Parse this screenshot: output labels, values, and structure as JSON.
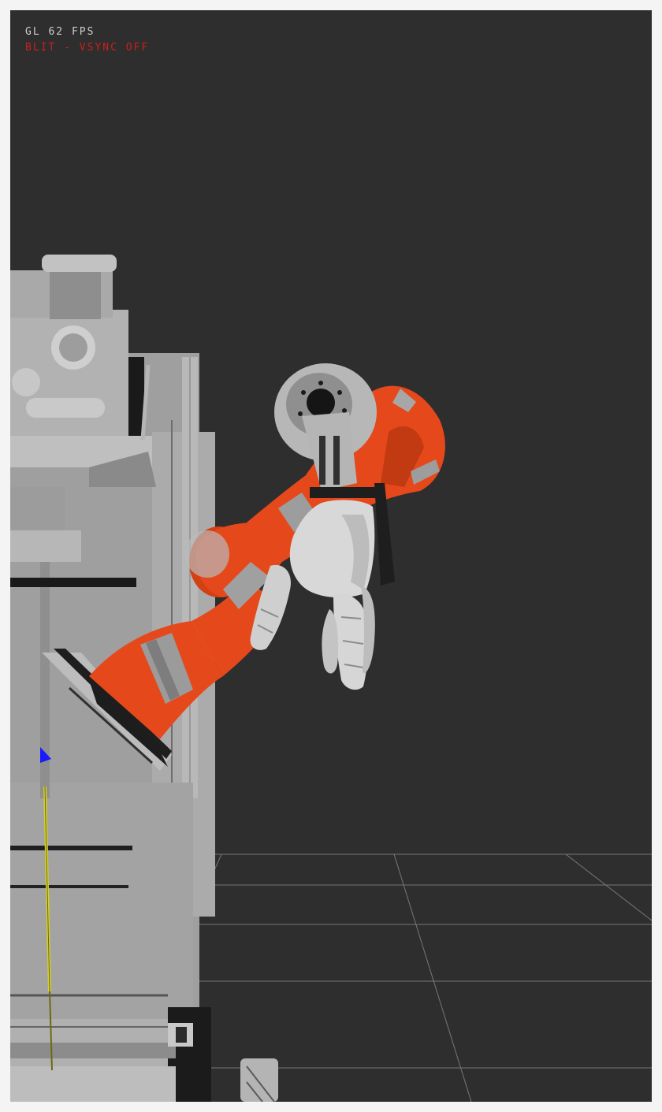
{
  "hud": {
    "fps_text": "GL 62 FPS",
    "mode_text": "BLIT - VSYNC OFF",
    "fps_color": "#cfcfcf",
    "mode_color": "#c8211b"
  },
  "scene": {
    "background_color": "#2e2e2e",
    "robot_arm_color": "#e5491b",
    "robot_body_color": "#a6a6a6",
    "robot_hand_color": "#d8d8d8",
    "floor_grid_color": "#8a8a8a",
    "calibration_rod_color": "#d4cf2a",
    "marker_color": "#1a1aff"
  }
}
